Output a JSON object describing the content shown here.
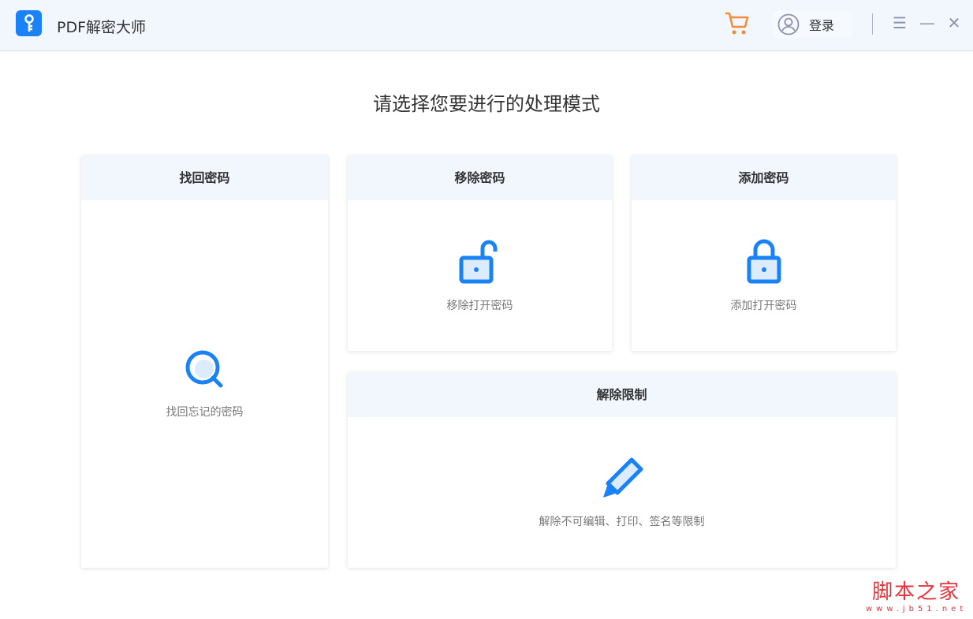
{
  "app": {
    "title": "PDF解密大师",
    "login_label": "登录"
  },
  "main": {
    "heading": "请选择您要进行的处理模式",
    "cards": [
      {
        "title": "找回密码",
        "desc": "找回忘记的密码"
      },
      {
        "title": "移除密码",
        "desc": "移除打开密码"
      },
      {
        "title": "添加密码",
        "desc": "添加打开密码"
      },
      {
        "title": "解除限制",
        "desc": "解除不可编辑、打印、签名等限制"
      }
    ]
  },
  "watermark": {
    "name": "脚本之家",
    "url": "www.jb51.net"
  },
  "colors": {
    "accent": "#1a82f7",
    "cart": "#f7893a"
  }
}
